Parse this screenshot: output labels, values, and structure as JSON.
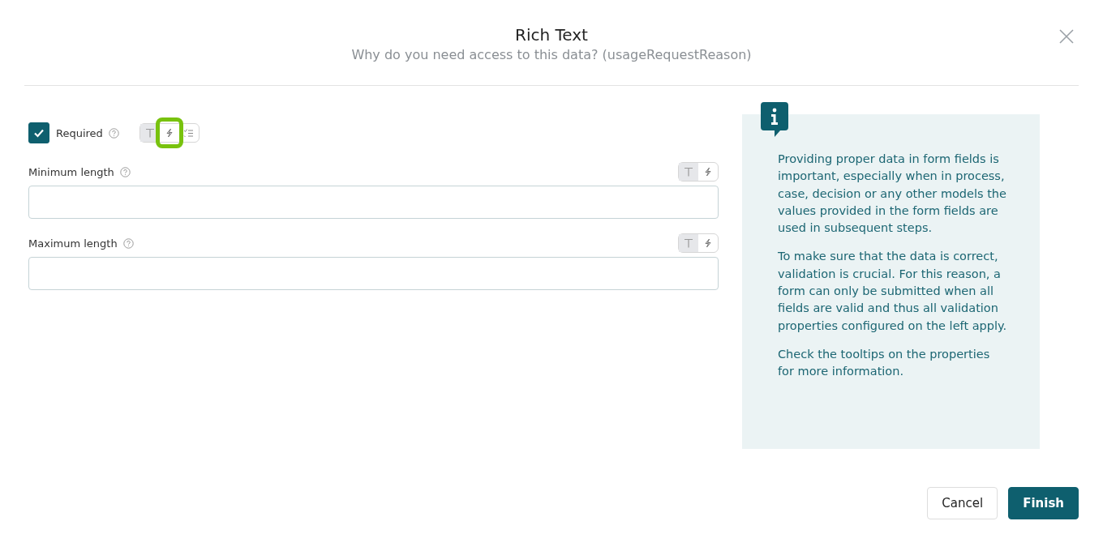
{
  "dialog": {
    "title": "Rich Text",
    "subtitle": "Why do you need access to this data? (usageRequestReason)"
  },
  "required": {
    "label": "Required",
    "checked": true,
    "options": [
      {
        "kind": "text",
        "selected": true,
        "highlighted": false
      },
      {
        "kind": "expression",
        "selected": false,
        "highlighted": true
      },
      {
        "kind": "list",
        "selected": false,
        "highlighted": false
      }
    ]
  },
  "fields": [
    {
      "label": "Minimum length",
      "options": [
        {
          "kind": "text",
          "selected": true,
          "highlighted": false
        },
        {
          "kind": "expression",
          "selected": false,
          "highlighted": false
        }
      ]
    },
    {
      "label": "Maximum length",
      "options": [
        {
          "kind": "text",
          "selected": true,
          "highlighted": false
        },
        {
          "kind": "expression",
          "selected": false,
          "highlighted": false
        }
      ]
    }
  ],
  "info": {
    "paragraphs": [
      "Providing proper data in form fields is important, especially when in process, case, decision or any other models the values provided in the form fields are used in subsequent steps.",
      "To make sure that the data is correct, validation is crucial. For this reason, a form can only be submitted when all fields are valid and thus all validation properties configured on the left apply.",
      "Check the tooltips on the properties for more information."
    ]
  },
  "buttons": [
    {
      "label": "Cancel",
      "kind": "secondary"
    },
    {
      "label": "Finish",
      "kind": "primary"
    }
  ]
}
